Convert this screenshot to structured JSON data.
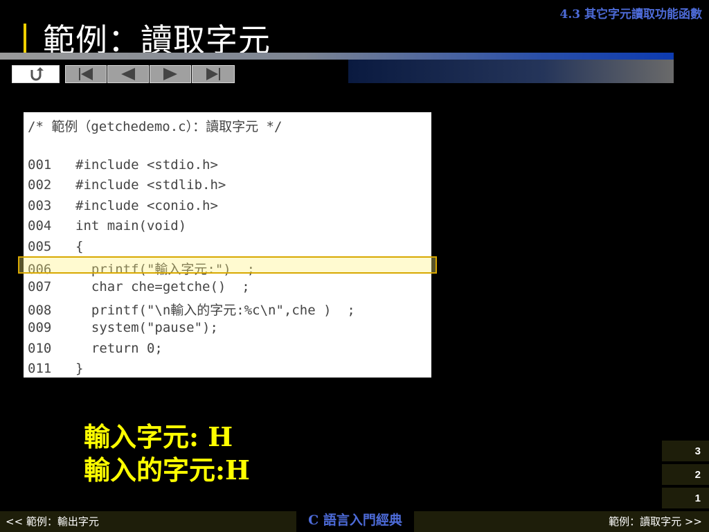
{
  "header": {
    "section": "4.3  其它字元讀取功能函數",
    "title": "範例：讀取字元"
  },
  "nav": {
    "buttons": [
      "return-icon",
      "first-page-icon",
      "previous-page-icon",
      "next-page-icon",
      "last-page-icon"
    ]
  },
  "code": {
    "comment": "/* 範例（getchedemo.c）：讀取字元 */",
    "lines": [
      {
        "num": "001",
        "text": "#include <stdio.h>"
      },
      {
        "num": "002",
        "text": "#include <stdlib.h>"
      },
      {
        "num": "003",
        "text": "#include <conio.h>"
      },
      {
        "num": "004",
        "text": "int main(void)"
      },
      {
        "num": "005",
        "text": "{"
      },
      {
        "num": "006",
        "text": "  printf(\"輸入字元:\")  ;"
      },
      {
        "num": "007",
        "text": "  char che=getche()  ;"
      },
      {
        "num": "008",
        "text": "  printf(\"\\n輸入的字元:%c\\n\",che )  ;"
      },
      {
        "num": "009",
        "text": "  system(\"pause\");"
      },
      {
        "num": "010",
        "text": "  return 0;"
      },
      {
        "num": "011",
        "text": "}"
      }
    ],
    "highlighted_line": "006"
  },
  "output": {
    "line1": "輸入字元: H",
    "line2": "輸入的字元:H"
  },
  "pages": [
    "3",
    "2",
    "1"
  ],
  "footer": {
    "prev": "<< 範例：輸出字元",
    "center": "C 語言入門經典",
    "next": "範例：讀取字元 >>"
  },
  "colors": {
    "accent": "#4d6bd8",
    "output": "#ffff00",
    "title_bar": "#f0d000"
  }
}
